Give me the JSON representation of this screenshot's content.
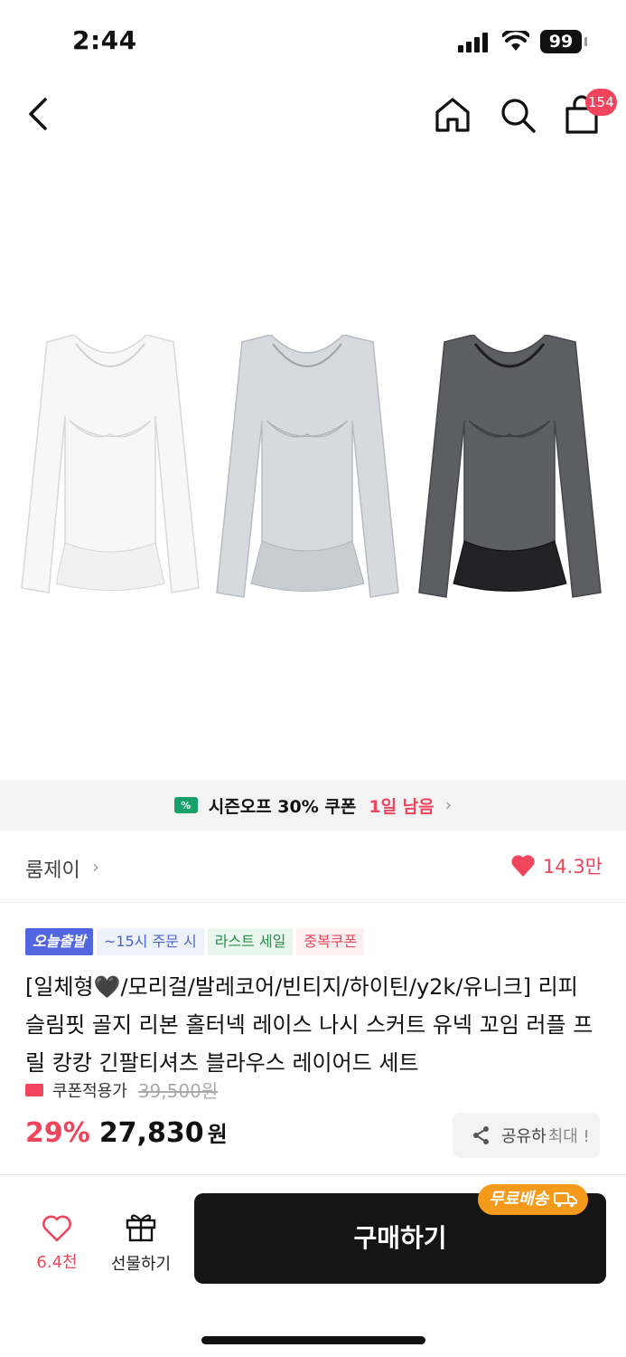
{
  "status_bar": {
    "time": "2:44",
    "battery": "99"
  },
  "nav": {
    "cart_count": "154"
  },
  "coupon_banner": {
    "text": "시즌오프 30% 쿠폰",
    "remaining": "1일 남음"
  },
  "shop": {
    "name": "룸제이",
    "likes": "14.3만"
  },
  "tags": [
    "오늘출발",
    "~15시 주문 시",
    "라스트 세일",
    "중복쿠폰"
  ],
  "product": {
    "title": "[일체형🖤/모리걸/발레코어/빈티지/하이틴/y2k/유니크] 리피 슬림핏 골지 리본 홀터넥 레이스 나시 스커트 유넥 꼬임 러플 프릴 캉캉 긴팔티셔츠 블라우스 레이어드 세트",
    "coupon_label": "쿠폰적용가",
    "original_price": "39,500원",
    "discount": "29%",
    "price": "27,830",
    "currency": "원"
  },
  "share": {
    "label": "공유하",
    "max": "최대 !"
  },
  "bottom": {
    "like_count": "6.4천",
    "gift_label": "선물하기",
    "buy_label": "구매하기",
    "free_shipping": "무료배송"
  },
  "colors": {
    "accent": "#f0455c",
    "tag_blue": "#5266e0",
    "shipping": "#f59a1b"
  },
  "icons": [
    "back-icon",
    "home-icon",
    "search-icon",
    "cart-icon",
    "heart-icon",
    "share-icon",
    "gift-icon",
    "truck-icon"
  ]
}
